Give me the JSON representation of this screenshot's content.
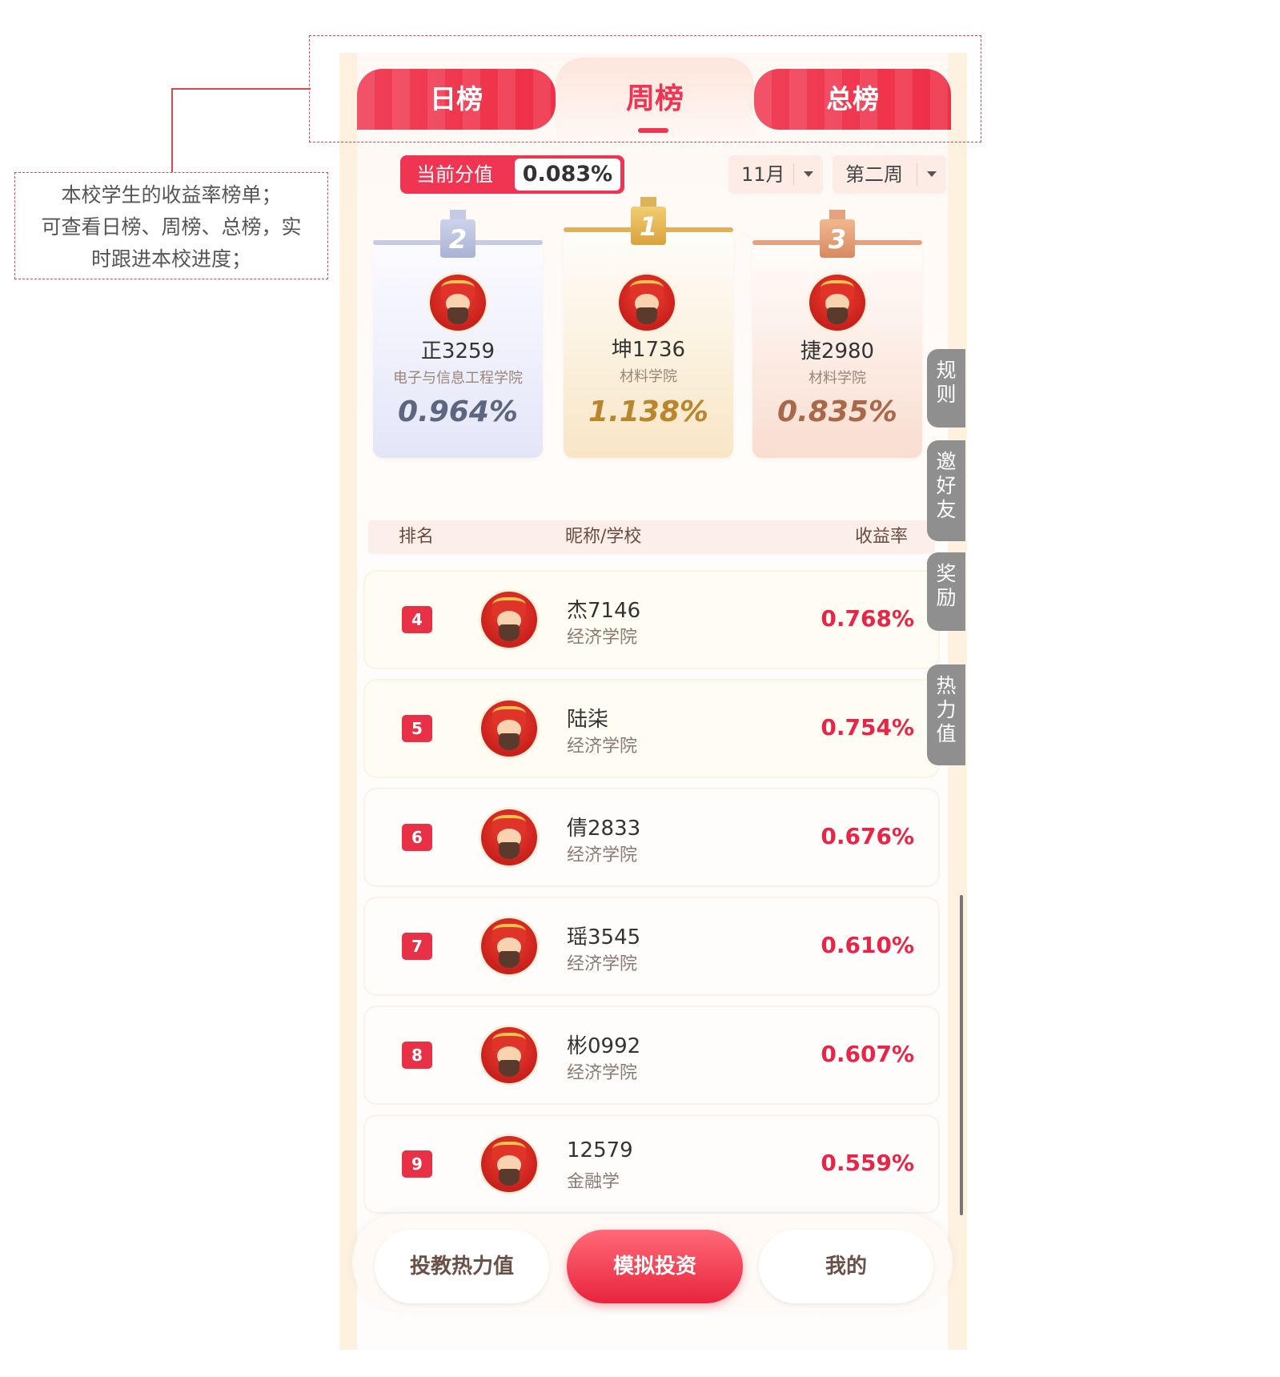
{
  "annotation": {
    "lines": [
      "本校学生的收益率榜单；",
      "可查看日榜、周榜、总榜，实",
      "时跟进本校进度；"
    ]
  },
  "tabs": [
    {
      "label": "日榜"
    },
    {
      "label": "周榜"
    },
    {
      "label": "总榜"
    }
  ],
  "score": {
    "label": "当前分值",
    "value": "0.083%"
  },
  "filters": {
    "month": "11月",
    "week": "第二周"
  },
  "podium": [
    {
      "rank": "2",
      "name": "正3259",
      "school": "电子与信息工程学院",
      "rate": "0.964%"
    },
    {
      "rank": "1",
      "name": "坤1736",
      "school": "材料学院",
      "rate": "1.138%"
    },
    {
      "rank": "3",
      "name": "捷2980",
      "school": "材料学院",
      "rate": "0.835%"
    }
  ],
  "list_header": {
    "rank": "排名",
    "name": "昵称/学校",
    "rate": "收益率"
  },
  "rows": [
    {
      "rank": "4",
      "name": "杰7146",
      "school": "经济学院",
      "rate": "0.768%"
    },
    {
      "rank": "5",
      "name": "陆柒",
      "school": "经济学院",
      "rate": "0.754%"
    },
    {
      "rank": "6",
      "name": "倩2833",
      "school": "经济学院",
      "rate": "0.676%"
    },
    {
      "rank": "7",
      "name": "瑶3545",
      "school": "经济学院",
      "rate": "0.610%"
    },
    {
      "rank": "8",
      "name": "彬0992",
      "school": "经济学院",
      "rate": "0.607%"
    },
    {
      "rank": "9",
      "name": "12579",
      "school": "金融学",
      "rate": "0.559%"
    }
  ],
  "side_buttons": [
    {
      "chars": [
        "规",
        "则"
      ]
    },
    {
      "chars": [
        "邀",
        "好",
        "友"
      ]
    },
    {
      "chars": [
        "奖",
        "励"
      ]
    },
    {
      "chars": [
        "热",
        "力",
        "值"
      ]
    }
  ],
  "bottom_nav": {
    "left": "投教热力值",
    "center": "模拟投资",
    "right": "我的"
  },
  "colors": {
    "accent": "#ef3552",
    "rate": "#e82447",
    "gold": "#dcb25a",
    "silver": "#c5cbe4",
    "bronze": "#e5a27e"
  },
  "icons": [
    "avatar-icon",
    "dropdown-caret-icon",
    "crown-icon"
  ]
}
